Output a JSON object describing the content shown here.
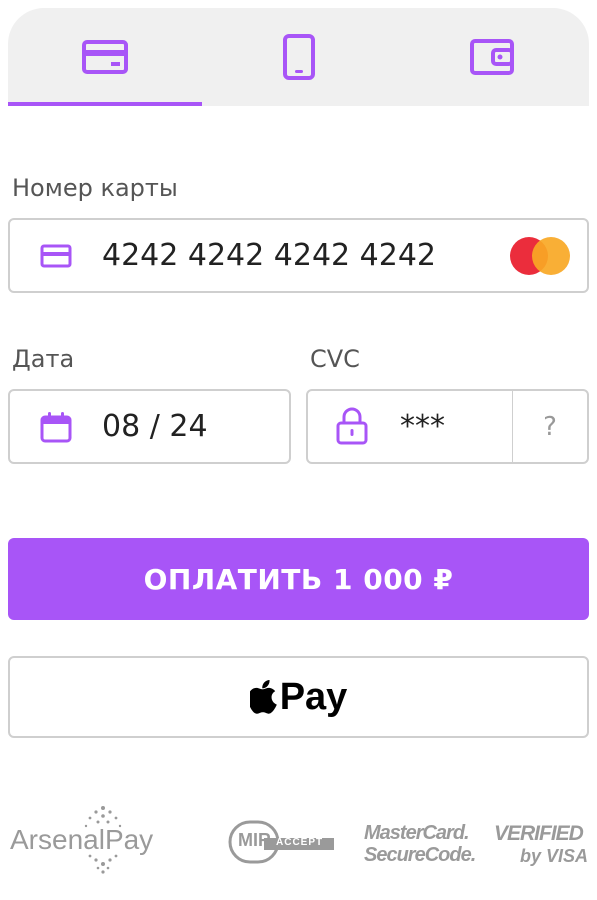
{
  "tabs": [
    {
      "icon": "credit-card-icon",
      "active": true
    },
    {
      "icon": "phone-icon",
      "active": false
    },
    {
      "icon": "wallet-icon",
      "active": false
    }
  ],
  "card": {
    "label": "Номер карты",
    "value": "4242 4242 4242 4242",
    "brand_icon": "mastercard-icon"
  },
  "date": {
    "label": "Дата",
    "value": "08 / 24"
  },
  "cvc": {
    "label": "CVC",
    "value": "***",
    "help": "?"
  },
  "pay_button": "ОПЛАТИТЬ 1 000 ₽",
  "apple_pay": {
    "text": "Pay"
  },
  "footer": {
    "arsenal": "ArsenalPay",
    "mir": "MIR",
    "mir_sub": "ACCEPT",
    "mastercard_1": "MasterCard.",
    "mastercard_2": "SecureCode.",
    "visa_1": "VERIFIED",
    "visa_2": "by VISA"
  },
  "colors": {
    "accent": "#a855f7",
    "border": "#cfcfcf"
  }
}
